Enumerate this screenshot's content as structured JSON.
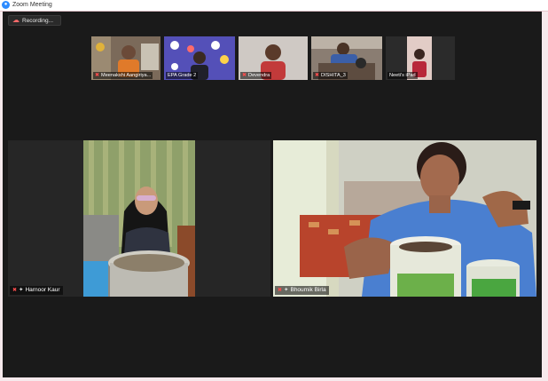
{
  "window": {
    "title": "Zoom Meeting"
  },
  "recording": {
    "label": "Recording..."
  },
  "participants_strip": [
    {
      "name": "Meenakshi Aangiriya...",
      "muted": true
    },
    {
      "name": "EPA Grade 2",
      "muted": false
    },
    {
      "name": "Devendra",
      "muted": true
    },
    {
      "name": "DISHITA_3",
      "muted": true
    },
    {
      "name": "Neeti's iPad",
      "muted": false
    }
  ],
  "main_tiles": [
    {
      "name": "Harnoor Kaur",
      "muted": true
    },
    {
      "name": "Bhoumik Birla",
      "muted": true
    }
  ],
  "colors": {
    "muted_red": "#ff4d4d",
    "meeting_bg": "#1a1a1a",
    "zoom_blue": "#2d8cff"
  }
}
